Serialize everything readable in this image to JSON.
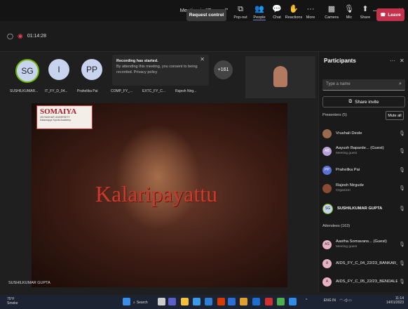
{
  "window": {
    "title": "Meeting in \"General\""
  },
  "toolbar": {
    "timer": "01:14:28",
    "request_control": "Request control",
    "popout": "Pop-out",
    "people": "People",
    "chat": "Chat",
    "reactions": "Reactions",
    "more": "More",
    "camera": "Camera",
    "mic": "Mic",
    "share": "Share",
    "leave": "Leave"
  },
  "gallery": {
    "avatars": [
      {
        "initials": "SG",
        "name": "SUSHILKUMAR..."
      },
      {
        "initials": "I",
        "name": "IT_FY_D_04..."
      },
      {
        "initials": "PP",
        "name": "Prahelika Pai"
      }
    ],
    "extra_names": [
      "COMP_FY_...",
      "EXTC_FY_C...",
      "Rajesh Nirg..."
    ],
    "overflow_count": "+161"
  },
  "recording": {
    "title": "Recording has started.",
    "body": "By attending this meeting, you consent to being recorded. Privacy policy"
  },
  "video": {
    "logo_name": "SOMAIYA",
    "logo_sub": "VIDYAVIHAR UNIVERSITY",
    "logo_sub2": "Katamayya Sports Academy",
    "overlay_text": "Kalaripayattu",
    "speaker": "SUSHILKUMAR GUPTA"
  },
  "panel": {
    "title": "Participants",
    "search_placeholder": "Type a name",
    "share_invite": "Share invite",
    "presenters_label": "Presenters (5)",
    "mute_all": "Mute all",
    "presenters": [
      {
        "initials": "",
        "name": "Vrushali Deole",
        "sub": ""
      },
      {
        "initials": "AB",
        "name": "Aayush Baparde... (Guest)",
        "sub": "Meeting guest"
      },
      {
        "initials": "PP",
        "name": "Prahelika Pai",
        "sub": ""
      },
      {
        "initials": "",
        "name": "Rajesh Nirgude",
        "sub": "Organizer"
      },
      {
        "initials": "SG",
        "name": "SUSHILKUMAR GUPTA",
        "sub": ""
      }
    ],
    "attendees_label": "Attendees (163)",
    "attendees": [
      {
        "initials": "AS",
        "name": "Aastha Somavans... (Guest)",
        "sub": "Meeting guest"
      },
      {
        "initials": "A",
        "name": "AIDS_FY_C_04_22/23_BANKAR_O...",
        "sub": ""
      },
      {
        "initials": "A",
        "name": "AIDS_FY_C_05_22/23_BENDALE_...",
        "sub": ""
      }
    ]
  },
  "taskbar": {
    "temp": "75°F",
    "weather": "Smoke",
    "search": "Search",
    "lang": "ENG",
    "region": "IN",
    "time": "11:14",
    "date": "14/01/2023"
  },
  "colors": {
    "leave": "#c4314b",
    "accent": "#7c86c8"
  }
}
